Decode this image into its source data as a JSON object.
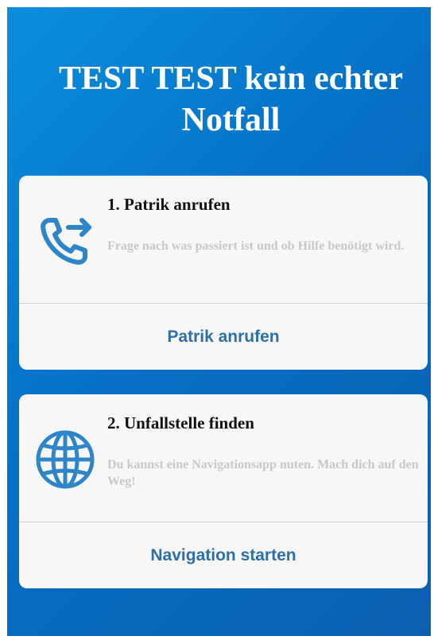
{
  "header": {
    "title": "TEST TEST kein echter Notfall"
  },
  "cards": [
    {
      "title": "1. Patrik anrufen",
      "description": "Frage nach was passiert ist und ob Hilfe benötigt wird.",
      "action_label": "Patrik anrufen",
      "icon": "phone-forward-icon"
    },
    {
      "title": "2. Unfallstelle finden",
      "description": "Du kannst eine Navigationsapp nuten. Mach dich auf den Weg!",
      "action_label": "Navigation starten",
      "icon": "globe-icon"
    }
  ],
  "colors": {
    "background_gradient_start": "#0a8fdc",
    "background_gradient_end": "#0b5fb0",
    "icon": "#2e86c8",
    "action_text": "#2f6fa7",
    "card_background": "#f7f7f7"
  }
}
